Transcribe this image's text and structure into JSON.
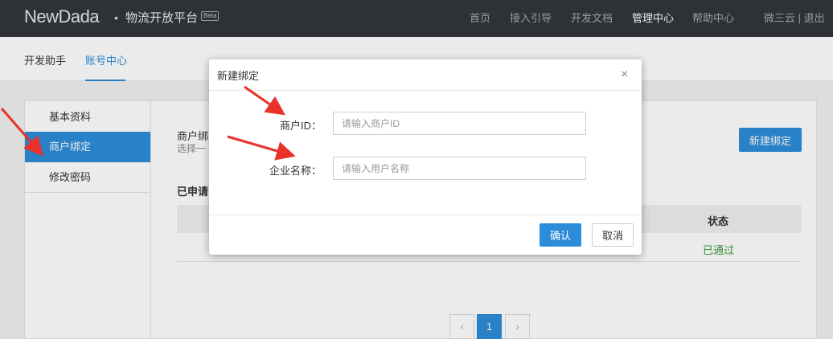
{
  "header": {
    "logo": "NewDada",
    "separator": "•",
    "platform": "物流开放平台",
    "beta": "Beta",
    "nav": [
      "首页",
      "接入引导",
      "开发文档",
      "管理中心",
      "帮助中心"
    ],
    "user": "微三云 | 退出"
  },
  "subnav": {
    "tabs": [
      "开发助手",
      "账号中心"
    ]
  },
  "sidebar": {
    "items": [
      "基本资料",
      "商户绑定",
      "修改密码"
    ]
  },
  "content": {
    "title": "商户绑",
    "subtitle": "选择一",
    "new_button": "新建绑定",
    "section_title": "已申请",
    "table": {
      "header_status": "状态",
      "row_status": "已通过"
    },
    "pagination": {
      "prev": "‹",
      "page": "1",
      "next": "›"
    }
  },
  "modal": {
    "title": "新建绑定",
    "close": "×",
    "merchant_id_label": "商户ID：",
    "merchant_id_placeholder": "请输入商户ID",
    "company_label": "企业名称：",
    "company_placeholder": "请输入用户名称",
    "ok": "确认",
    "cancel": "取消"
  },
  "colors": {
    "accent": "#2d8cd8",
    "success": "#3a9a3a",
    "annotation": "#e8322b",
    "topbar": "#32363a"
  }
}
